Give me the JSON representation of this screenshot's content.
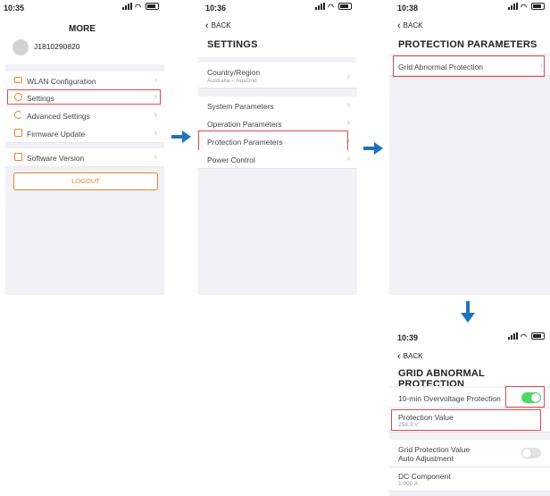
{
  "status": {
    "p1_time": "10:35",
    "p2_time": "10:36",
    "p3_time": "10:38",
    "p4_time": "10:39"
  },
  "common": {
    "back_label": "BACK"
  },
  "more": {
    "title": "MORE",
    "user_id": "J1810290820",
    "menu": [
      {
        "label": "WLAN Configuration",
        "icon": "router-icon"
      },
      {
        "label": "Settings",
        "icon": "gear-icon"
      },
      {
        "label": "Advanced Settings",
        "icon": "advanced-settings-icon"
      },
      {
        "label": "Firmware Update",
        "icon": "firmware-icon"
      }
    ],
    "software_version": "Software Version",
    "logout": "LOGOUT"
  },
  "settings": {
    "title": "SETTINGS",
    "country_label": "Country/Region",
    "country_value": "Australia – AusGrid",
    "items": [
      "System Parameters",
      "Operation Parameters",
      "Protection Parameters",
      "Power Control"
    ]
  },
  "protection": {
    "title": "PROTECTION PARAMETERS",
    "item": "Grid Abnormal Protection"
  },
  "grid": {
    "title": "GRID ABNORMAL PROTECTION",
    "overvoltage_label": "10-min Overvoltage Protection",
    "overvoltage_on": true,
    "protection_value_label": "Protection Value",
    "protection_value": "258.0 V",
    "auto_adjust_label_1": "Grid Protection Value",
    "auto_adjust_label_2": "Auto Adjustment",
    "auto_adjust_on": false,
    "dc_label": "DC Component",
    "dc_value": "1.000 A"
  },
  "colors": {
    "accent_orange": "#e8862c",
    "highlight_red": "#e0474c",
    "arrow_blue": "#1e73be",
    "toggle_green": "#4cd964"
  }
}
